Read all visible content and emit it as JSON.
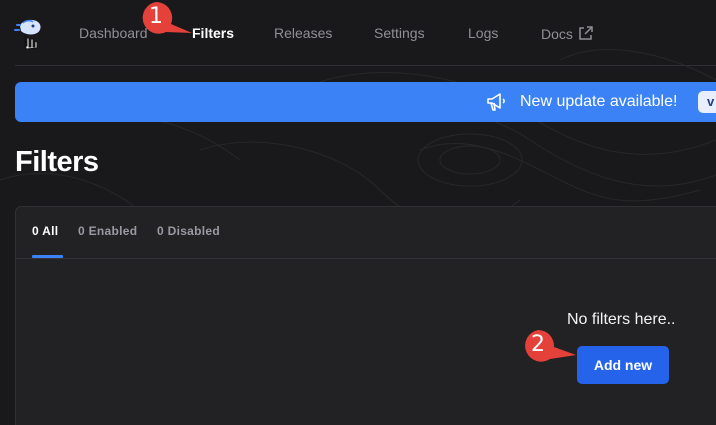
{
  "nav": {
    "items": [
      {
        "label": "Dashboard",
        "active": false
      },
      {
        "label": "Filters",
        "active": true
      },
      {
        "label": "Releases",
        "active": false
      },
      {
        "label": "Settings",
        "active": false
      },
      {
        "label": "Logs",
        "active": false
      },
      {
        "label": "Docs",
        "active": false,
        "icon": "external-link-icon"
      }
    ]
  },
  "banner": {
    "text": "New update available!",
    "button_label": "v",
    "icon": "megaphone-icon",
    "color": "#3b82f6"
  },
  "page": {
    "title": "Filters"
  },
  "tabs": [
    {
      "label": "0 All",
      "active": true
    },
    {
      "label": "0 Enabled",
      "active": false
    },
    {
      "label": "0 Disabled",
      "active": false
    }
  ],
  "empty_state": {
    "message": "No filters here..",
    "button_label": "Add new",
    "button_color": "#2563eb"
  },
  "callouts": [
    {
      "number": "1",
      "color": "#e5413b"
    },
    {
      "number": "2",
      "color": "#e5413b"
    }
  ]
}
